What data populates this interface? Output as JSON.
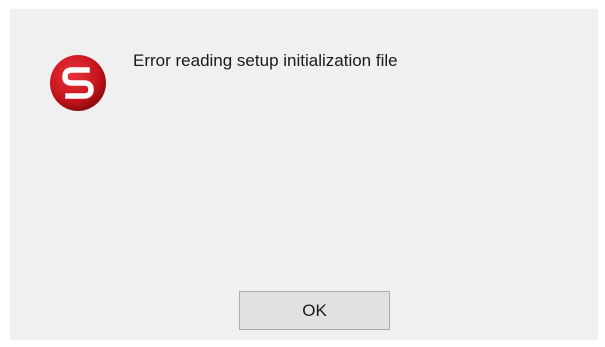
{
  "dialog": {
    "icon": "app-logo-icon",
    "message": "Error reading setup initialization file",
    "ok_label": "OK"
  },
  "colors": {
    "dialog_background": "#f0f0f0",
    "icon_red": "#c8141c",
    "button_background": "#e1e1e1",
    "button_border": "#adadad"
  }
}
